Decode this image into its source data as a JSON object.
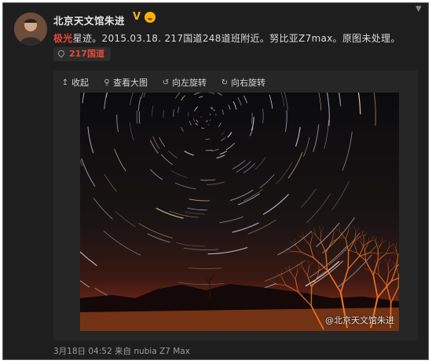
{
  "post": {
    "author": "北京天文馆朱进",
    "verified_badge": "V",
    "highlight_word": "极光",
    "text": "星迹。2015.03.18. 217国道248道班附近。努比亚Z7max。原图未处理。",
    "location": "217国道",
    "timestamp": "3月18日 04:52 来自 nubia Z7 Max"
  },
  "toolbar": {
    "collapse": "收起",
    "view_large": "查看大图",
    "rotate_left": "向左旋转",
    "rotate_right": "向右旋转"
  },
  "photo": {
    "watermark": "@北京天文馆朱进"
  },
  "colors": {
    "background": "#1e1e1e",
    "highlight": "#e8473c",
    "verified": "#f2b01e",
    "text": "#dcdcdc"
  },
  "icons": {
    "location": "location-pin-icon",
    "collapse": "arrow-up-icon",
    "view_large": "magnifier-icon",
    "rotate_left": "rotate-left-icon",
    "rotate_right": "rotate-right-icon"
  }
}
